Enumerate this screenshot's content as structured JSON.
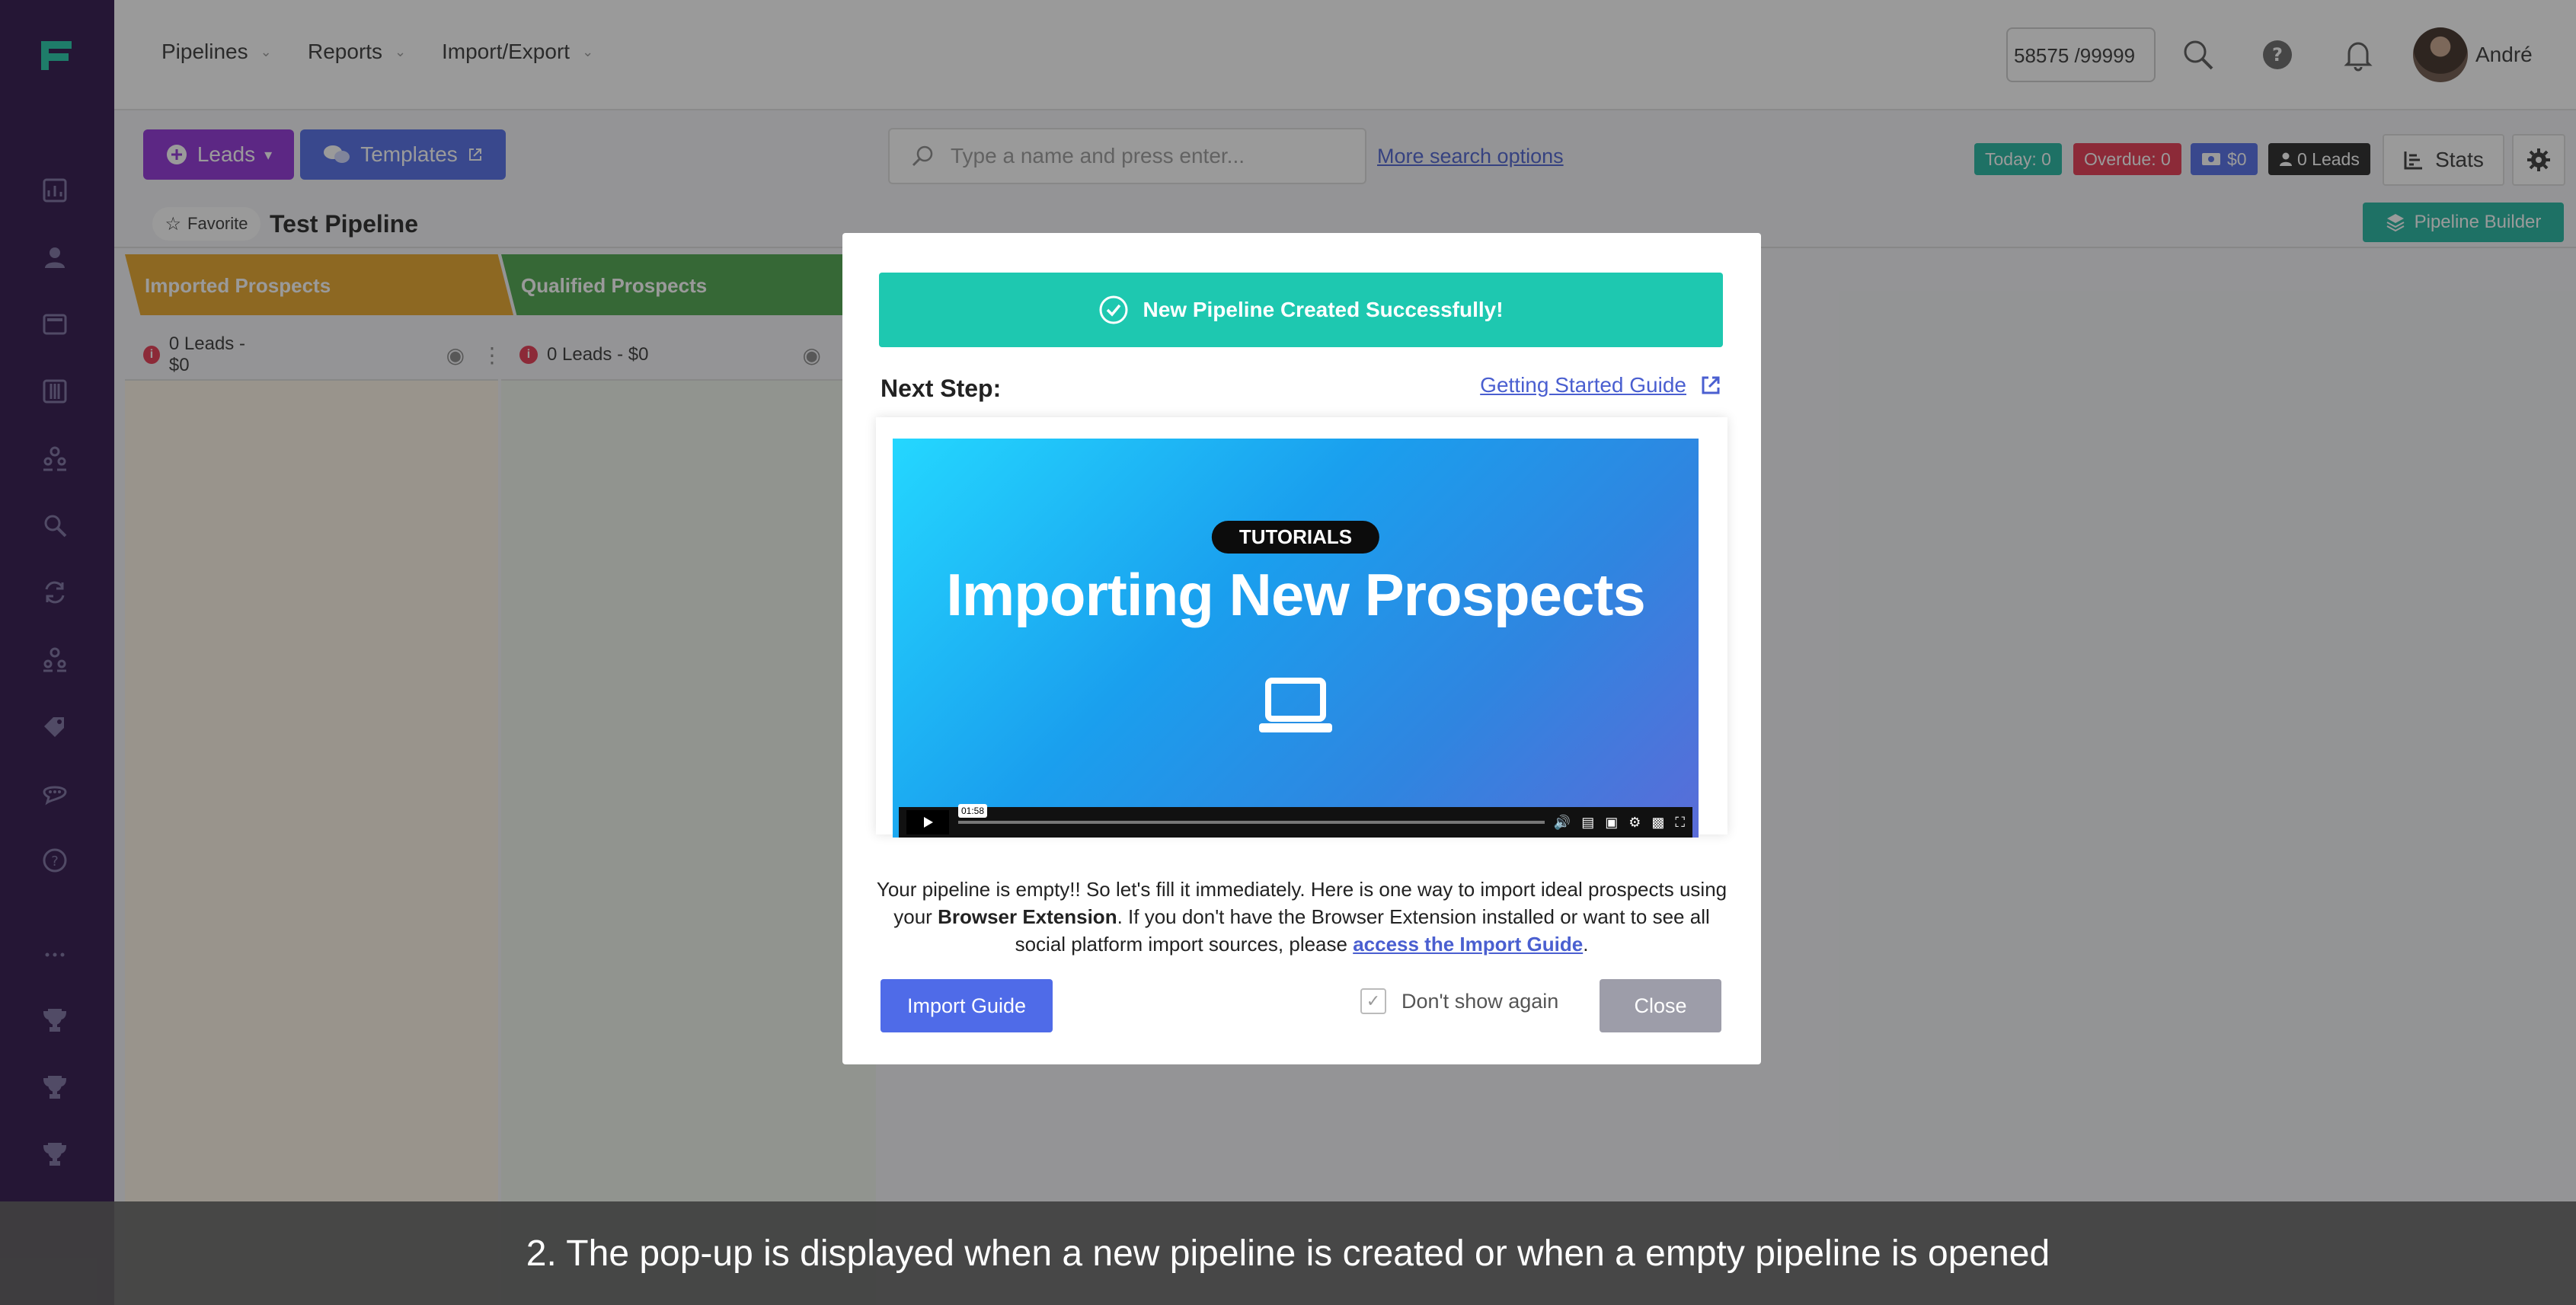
{
  "topnav": {
    "items": [
      {
        "label": "Pipelines"
      },
      {
        "label": "Reports"
      },
      {
        "label": "Import/Export"
      }
    ],
    "credits": "58575 /99999",
    "user": "André"
  },
  "toolbar": {
    "leads_label": "Leads",
    "templates_label": "Templates",
    "search_placeholder": "Type a name and press enter...",
    "more_search": "More search options",
    "badges": {
      "today": "Today: 0",
      "overdue": "Overdue: 0",
      "money": "$0",
      "leads": "0 Leads"
    },
    "stats_label": "Stats"
  },
  "pipeline": {
    "favorite_label": "Favorite",
    "title": "Test Pipeline",
    "builder_label": "Pipeline Builder",
    "columns": [
      {
        "name": "Imported Prospects",
        "summary": "0 Leads - $0",
        "color": "#e8a526"
      },
      {
        "name": "Qualified Prospects",
        "summary": "0 Leads - $0",
        "color": "#4aa54a"
      }
    ]
  },
  "modal": {
    "success": "New Pipeline Created Successfully!",
    "next_step": "Next Step:",
    "guide_link": "Getting Started Guide",
    "video": {
      "badge": "TUTORIALS",
      "title": "Importing New Prospects",
      "time": "01:58"
    },
    "text_1": "Your pipeline is empty!! So let's fill it immediately. Here is one way to import ideal prospects using your ",
    "text_bold": "Browser Extension",
    "text_2": ". If you don't have the Browser Extension installed or want to see all social platform import sources, please ",
    "text_link": "access the Import Guide",
    "text_3": ".",
    "import_button": "Import Guide",
    "dont_show": "Don't show again",
    "close_button": "Close"
  },
  "caption": "2. The pop-up is displayed when a new pipeline is created or when a empty pipeline is opened",
  "colors": {
    "sidebar": "#2a0f48",
    "success": "#1ec8b0",
    "primary": "#4f6be8",
    "leads_button": "#8e2fd8"
  }
}
